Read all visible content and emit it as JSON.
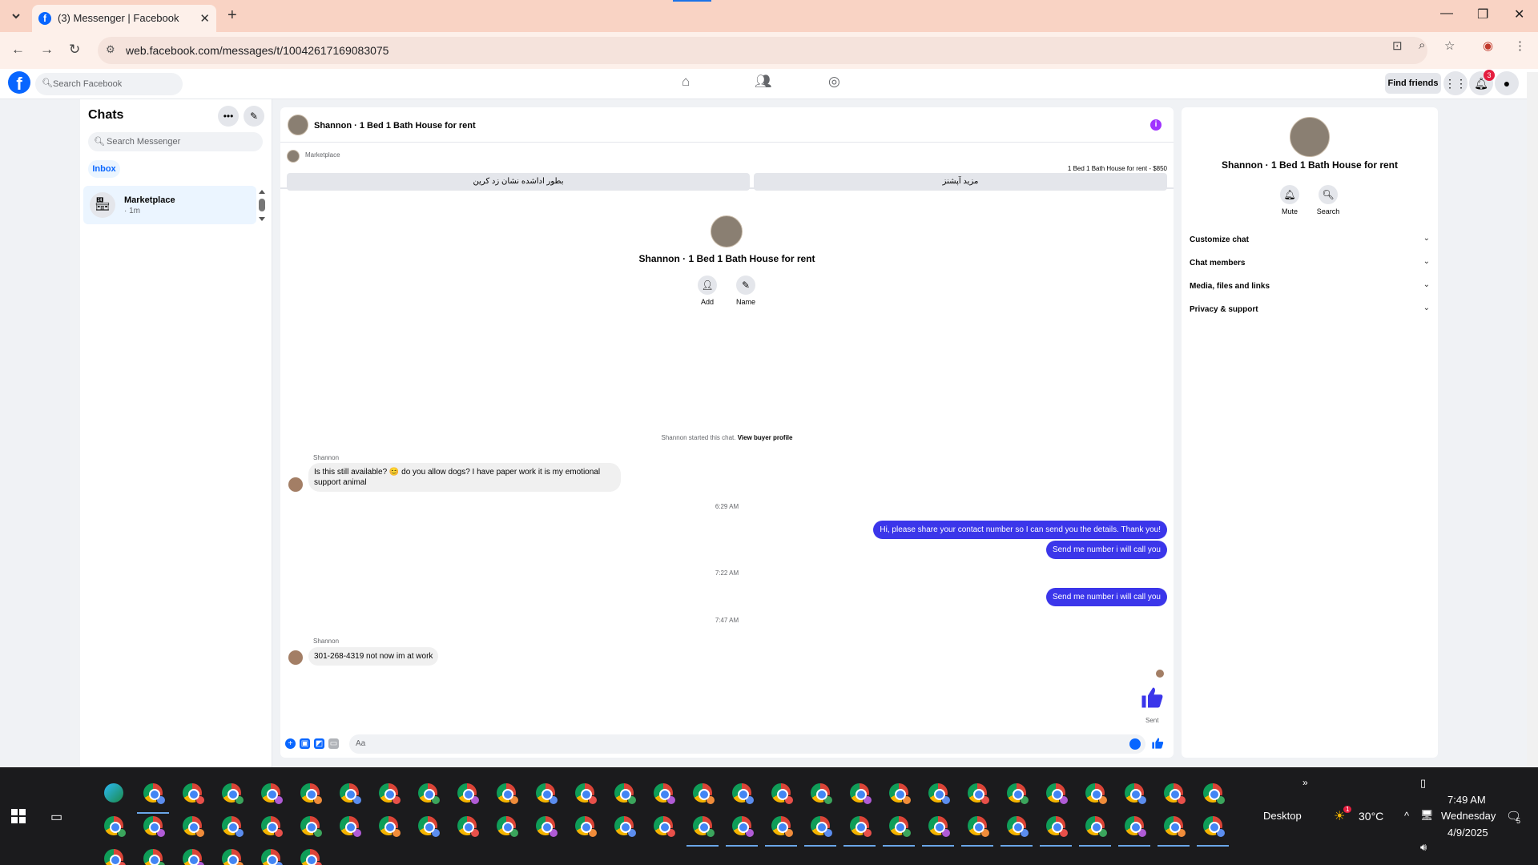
{
  "browser": {
    "tab_title": "(3) Messenger | Facebook",
    "url": "web.facebook.com/messages/t/10042617169083075"
  },
  "fb_header": {
    "search_placeholder": "Search Facebook",
    "find_friends": "Find friends",
    "notification_count": "3"
  },
  "sidebar": {
    "title": "Chats",
    "search_placeholder": "Search Messenger",
    "filter": "Inbox",
    "chats": [
      {
        "name": "Marketplace",
        "time": "· 1m"
      }
    ]
  },
  "chat": {
    "header_name": "Shannon · 1 Bed 1 Bath House for rent",
    "marketplace_label": "Marketplace",
    "product_line": "1 Bed 1 Bath House for rent - $850",
    "action_left": "بطور اداشده نشان زد کرین",
    "action_right": "مزید آپشنز",
    "intro_name": "Shannon · 1 Bed 1 Bath House for rent",
    "intro_actions": {
      "add": "Add",
      "name": "Name"
    },
    "system_text": "Shannon started this chat.",
    "system_link": "View buyer profile",
    "messages": [
      {
        "sender": "Shannon",
        "text": "Is this still available? 😊 do you allow dogs? I have paper work it is my emotional support animal"
      },
      {
        "timestamp": "6:29 AM"
      },
      {
        "outgoing": [
          "Hi, please share your contact number so I can send you the details. Thank you!",
          "Send me number i will call you"
        ]
      },
      {
        "timestamp": "7:22 AM"
      },
      {
        "outgoing": [
          "Send me number i will call you"
        ]
      },
      {
        "timestamp": "7:47 AM"
      },
      {
        "sender": "Shannon",
        "text": "301-268-4319 not now im at work"
      }
    ],
    "status": "Sent",
    "composer_placeholder": "Aa"
  },
  "info_panel": {
    "name": "Shannon · 1 Bed 1 Bath House for rent",
    "actions": {
      "mute": "Mute",
      "search": "Search"
    },
    "sections": [
      "Customize chat",
      "Chat members",
      "Media, files and links",
      "Privacy & support"
    ]
  },
  "taskbar": {
    "desktop_label": "Desktop",
    "temperature": "30°C",
    "weather_badge": "1",
    "time": "7:49 AM",
    "day": "Wednesday",
    "date": "4/9/2025",
    "notif_count": "5"
  },
  "colors": {
    "accent": "#0866ff",
    "outgoing_bubble": "#3b36ea",
    "tabbar": "#f9d3c4"
  }
}
